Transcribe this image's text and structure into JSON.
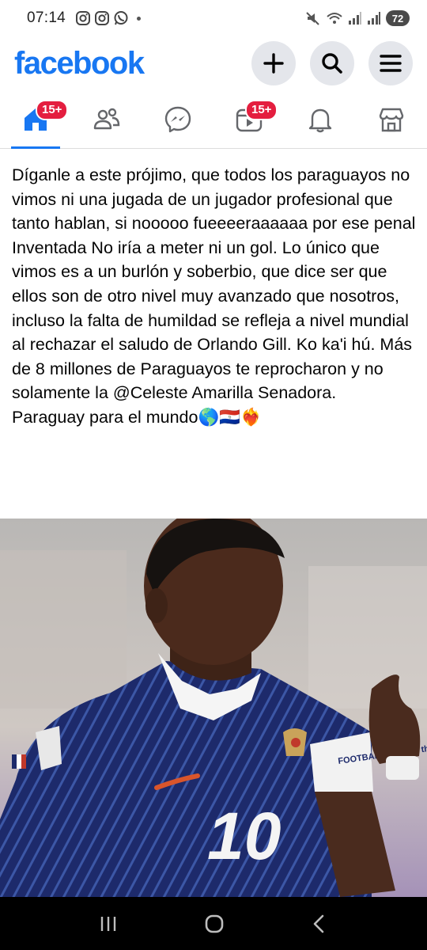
{
  "status_bar": {
    "time": "07:14",
    "battery": "72",
    "left_icons": [
      "instagram-icon",
      "instagram-icon",
      "whatsapp-icon"
    ],
    "right_icons": [
      "mute-icon",
      "wifi-icon",
      "signal-icon",
      "signal-icon"
    ]
  },
  "header": {
    "logo": "facebook",
    "actions": [
      "plus-icon",
      "search-icon",
      "menu-icon"
    ]
  },
  "nav": {
    "tabs": [
      {
        "name": "home",
        "badge": "15+",
        "active": true
      },
      {
        "name": "friends",
        "badge": ""
      },
      {
        "name": "messenger",
        "badge": ""
      },
      {
        "name": "video",
        "badge": "15+"
      },
      {
        "name": "notifications",
        "badge": ""
      },
      {
        "name": "marketplace",
        "badge": ""
      }
    ]
  },
  "post": {
    "text": "Díganle a este prójimo, que todos los paraguayos no vimos ni una jugada de un jugador profesional que tanto hablan, si nooooo fueeeeraaaaaa por ese penal Inventada No iría a meter ni un gol. Lo único que vimos es a un burlón y soberbio, que dice ser que ellos son de otro nivel muy avanzado que nosotros, incluso la falta de humildad se refleja a nivel mundial al rechazar el saludo de Orlando Gill. Ko ka'i hú. Más de 8 millones de Paraguayos te reprocharon y no solamente la @Celeste Amarilla Senadora.\nParaguay para el mundo🌎🇵🇾❤️‍🔥",
    "photo": {
      "jersey_number": "10",
      "armband_text": "FOOTBALL UNITES the world"
    }
  },
  "system_nav": [
    "recents-icon",
    "home-icon",
    "back-icon"
  ]
}
